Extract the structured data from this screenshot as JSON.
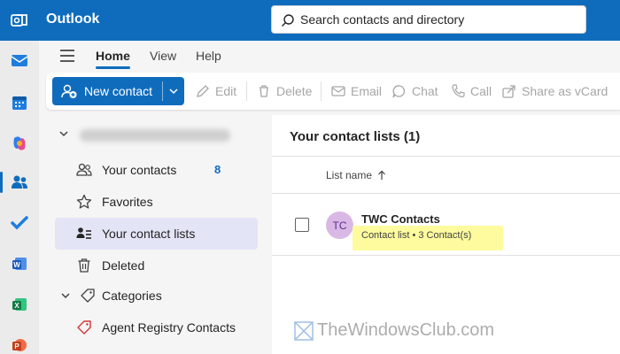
{
  "app": {
    "title": "Outlook"
  },
  "search": {
    "placeholder": "Search contacts and directory"
  },
  "rail": {
    "items": [
      {
        "icon": "mail-icon"
      },
      {
        "icon": "calendar-icon"
      },
      {
        "icon": "copilot-icon"
      },
      {
        "icon": "people-icon",
        "active": true
      },
      {
        "icon": "todo-icon"
      },
      {
        "icon": "word-icon"
      },
      {
        "icon": "excel-icon"
      },
      {
        "icon": "powerpoint-icon"
      }
    ]
  },
  "ribbon": {
    "tabs": [
      {
        "label": "Home",
        "active": true
      },
      {
        "label": "View"
      },
      {
        "label": "Help"
      }
    ],
    "new_contact_label": "New contact",
    "tools": {
      "edit": "Edit",
      "delete": "Delete",
      "email": "Email",
      "chat": "Chat",
      "call": "Call",
      "share": "Share as vCard"
    }
  },
  "folders": {
    "items": [
      {
        "label": "Your contacts",
        "count": "8",
        "icon": "people-icon"
      },
      {
        "label": "Favorites",
        "icon": "star-icon"
      },
      {
        "label": "Your contact lists",
        "icon": "contact-list-icon",
        "selected": true
      },
      {
        "label": "Deleted",
        "icon": "trash-icon"
      }
    ],
    "categories_label": "Categories",
    "category_items": [
      {
        "label": "Agent Registry Contacts",
        "icon": "tag-icon",
        "color": "#d13438"
      }
    ]
  },
  "main": {
    "header": "Your contact lists (1)",
    "column_header": "List name",
    "rows": [
      {
        "initials": "TC",
        "title": "TWC Contacts",
        "subtitle": "Contact list • 3 Contact(s)"
      }
    ]
  },
  "watermark": {
    "text": "TheWindowsClub.com"
  },
  "colors": {
    "brand": "#0f6cbd",
    "selected_bg": "#e3e4f5",
    "avatar_bg": "#d9b8e5",
    "highlight": "#fdfb9e"
  }
}
